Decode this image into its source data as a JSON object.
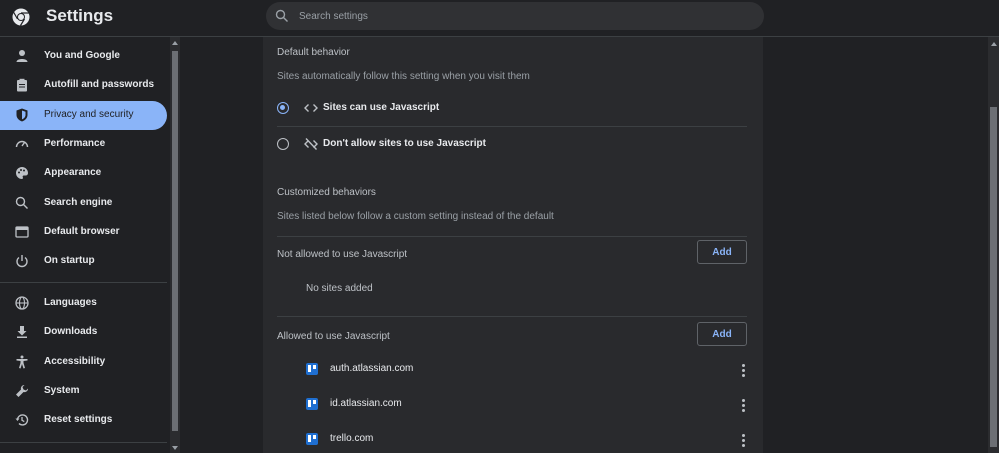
{
  "header": {
    "title": "Settings",
    "search_placeholder": "Search settings"
  },
  "sidebar": {
    "items": [
      {
        "label": "You and Google",
        "icon": "person-icon"
      },
      {
        "label": "Autofill and passwords",
        "icon": "clipboard-icon"
      },
      {
        "label": "Privacy and security",
        "icon": "shield-icon",
        "active": true
      },
      {
        "label": "Performance",
        "icon": "speedometer-icon"
      },
      {
        "label": "Appearance",
        "icon": "palette-icon"
      },
      {
        "label": "Search engine",
        "icon": "search-icon"
      },
      {
        "label": "Default browser",
        "icon": "browser-icon"
      },
      {
        "label": "On startup",
        "icon": "power-icon"
      },
      {
        "label": "Languages",
        "icon": "globe-icon"
      },
      {
        "label": "Downloads",
        "icon": "download-icon"
      },
      {
        "label": "Accessibility",
        "icon": "accessibility-icon"
      },
      {
        "label": "System",
        "icon": "wrench-icon"
      },
      {
        "label": "Reset settings",
        "icon": "history-icon"
      }
    ]
  },
  "main": {
    "default_behavior": {
      "heading": "Default behavior",
      "subtitle": "Sites automatically follow this setting when you visit them",
      "options": [
        {
          "label": "Sites can use Javascript",
          "icon": "code-icon",
          "checked": true
        },
        {
          "label": "Don't allow sites to use Javascript",
          "icon": "code-off-icon",
          "checked": false
        }
      ]
    },
    "customized": {
      "heading": "Customized behaviors",
      "subtitle": "Sites listed below follow a custom setting instead of the default",
      "not_allowed": {
        "label": "Not allowed to use Javascript",
        "add_label": "Add",
        "empty_text": "No sites added"
      },
      "allowed": {
        "label": "Allowed to use Javascript",
        "add_label": "Add",
        "sites": [
          "auth.atlassian.com",
          "id.atlassian.com",
          "trello.com"
        ]
      }
    }
  },
  "colors": {
    "accent": "#8ab4f8",
    "background": "#202124",
    "panel": "#292a2d"
  }
}
